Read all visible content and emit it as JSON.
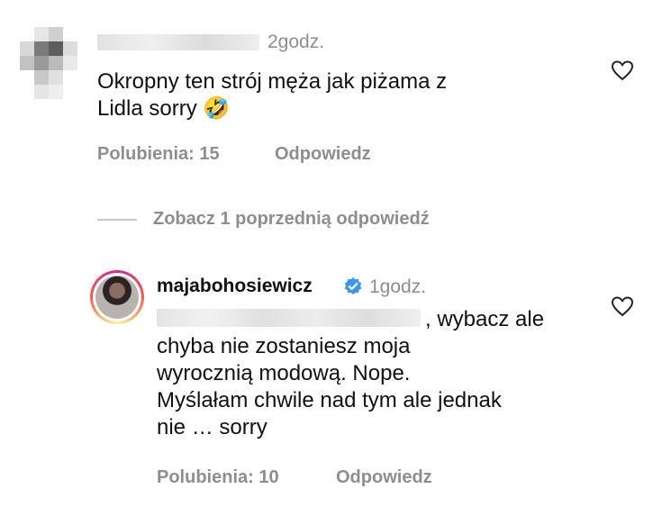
{
  "comment1": {
    "time": "2godz.",
    "text_line1": "Okropny ten strój męża jak piżama z",
    "text_line2": "Lidla sorry",
    "emoji": "🤣",
    "likes": "Polubienia: 15",
    "reply": "Odpowiedz"
  },
  "view_replies": "Zobacz 1 poprzednią odpowiedź",
  "reply1": {
    "username": "majabohosiewicz",
    "time": "1godz.",
    "text_line1": ", wybacz ale",
    "text_line2": "chyba nie zostaniesz moja",
    "text_line3": "wyrocznią modową. Nope.",
    "text_line4": "Myślałam chwile nad tym ale jednak",
    "text_line5": "nie … sorry",
    "likes": "Polubienia: 10",
    "reply": "Odpowiedz"
  },
  "colors": {
    "muted": "#8e8e8e",
    "verified": "#3897f0"
  },
  "icons": [
    "heart-icon",
    "verified-badge-icon"
  ]
}
